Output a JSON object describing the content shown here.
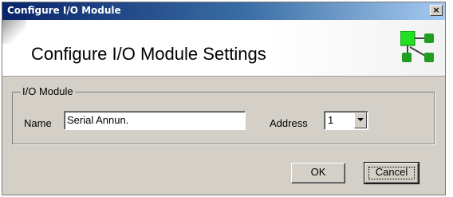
{
  "window": {
    "title": "Configure I/O Module",
    "close_label": "×"
  },
  "banner": {
    "heading": "Configure I/O Module Settings",
    "logo_icon": "network-nodes-icon",
    "logo_color": "#22b422"
  },
  "group": {
    "legend": "I/O Module",
    "name_label": "Name",
    "name_value": "Serial Annun.",
    "address_label": "Address",
    "address_value": "1"
  },
  "buttons": {
    "ok_label": "OK",
    "cancel_label": "Cancel"
  }
}
